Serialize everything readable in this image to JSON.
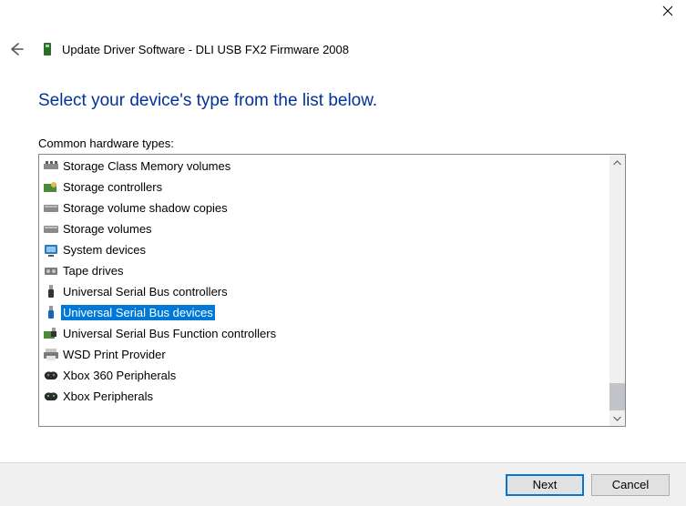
{
  "window": {
    "title": "Update Driver Software - DLI USB FX2 Firmware 2008"
  },
  "heading": "Select your device's type from the list below.",
  "list_label": "Common hardware types:",
  "items": [
    {
      "icon": "storage-class-memory-icon",
      "label": "Storage Class Memory volumes",
      "selected": false
    },
    {
      "icon": "storage-controllers-icon",
      "label": "Storage controllers",
      "selected": false
    },
    {
      "icon": "storage-shadow-icon",
      "label": "Storage volume shadow copies",
      "selected": false
    },
    {
      "icon": "storage-volumes-icon",
      "label": "Storage volumes",
      "selected": false
    },
    {
      "icon": "system-devices-icon",
      "label": "System devices",
      "selected": false
    },
    {
      "icon": "tape-drives-icon",
      "label": "Tape drives",
      "selected": false
    },
    {
      "icon": "usb-controllers-icon",
      "label": "Universal Serial Bus controllers",
      "selected": false
    },
    {
      "icon": "usb-devices-icon",
      "label": "Universal Serial Bus devices",
      "selected": true
    },
    {
      "icon": "usb-function-controllers-icon",
      "label": "Universal Serial Bus Function controllers",
      "selected": false
    },
    {
      "icon": "wsd-print-icon",
      "label": "WSD Print Provider",
      "selected": false
    },
    {
      "icon": "xbox-360-icon",
      "label": "Xbox 360 Peripherals",
      "selected": false
    },
    {
      "icon": "xbox-peripherals-icon",
      "label": "Xbox Peripherals",
      "selected": false
    }
  ],
  "buttons": {
    "next": "Next",
    "cancel": "Cancel"
  }
}
